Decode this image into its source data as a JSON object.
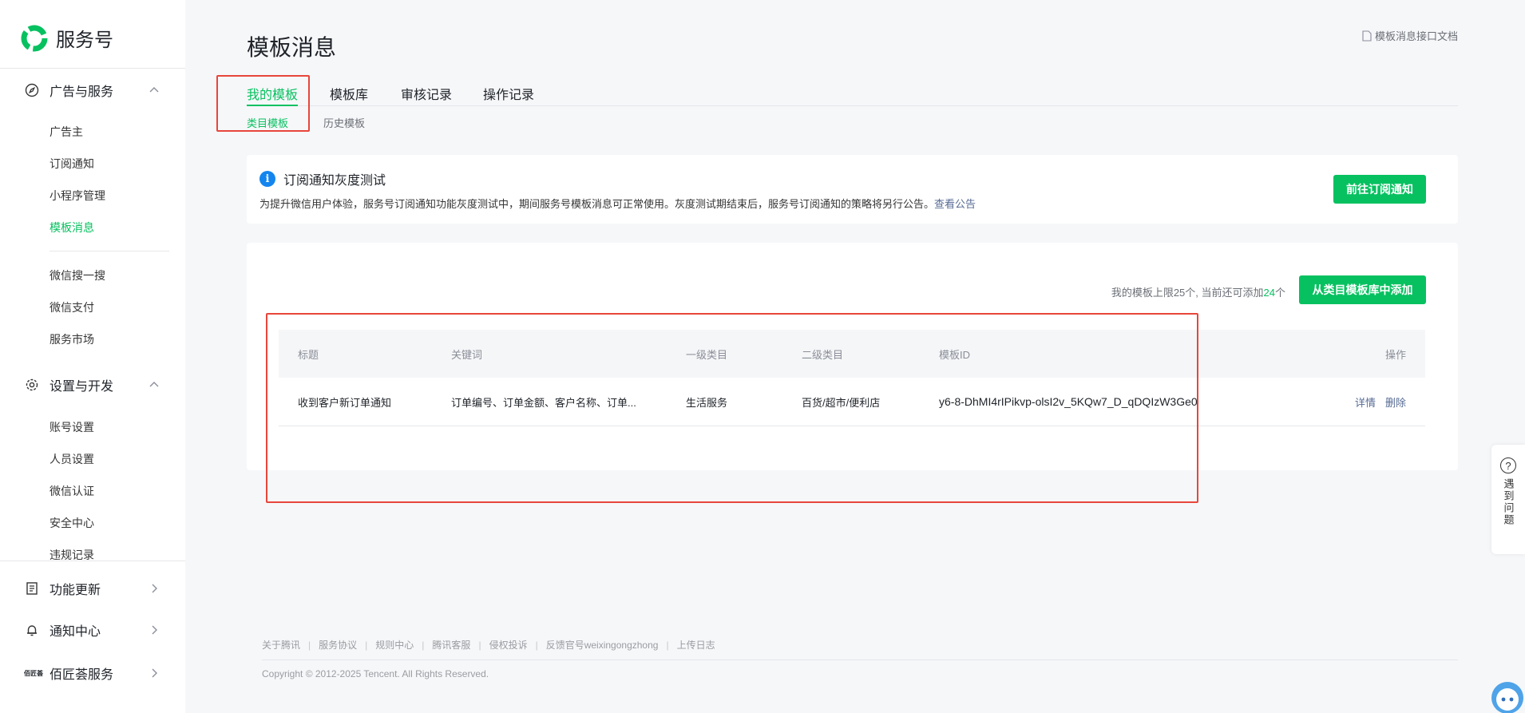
{
  "brand": {
    "name": "服务号"
  },
  "sidebar": {
    "groups": [
      {
        "label": "广告与服务",
        "items": [
          "广告主",
          "订阅通知",
          "小程序管理",
          "模板消息"
        ],
        "items2": [
          "微信搜一搜",
          "微信支付",
          "服务市场"
        ]
      },
      {
        "label": "设置与开发",
        "items": [
          "账号设置",
          "人员设置",
          "微信认证",
          "安全中心",
          "违规记录"
        ]
      }
    ],
    "bottom": [
      {
        "label": "功能更新"
      },
      {
        "label": "通知中心"
      },
      {
        "label": "佰匠荟服务",
        "avatar_text": "佰匠荟"
      }
    ]
  },
  "page": {
    "title": "模板消息",
    "doc_link": "模板消息接口文档",
    "tabs": [
      "我的模板",
      "模板库",
      "审核记录",
      "操作记录"
    ],
    "subtabs": [
      "类目模板",
      "历史模板"
    ]
  },
  "notice": {
    "title": "订阅通知灰度测试",
    "desc": "为提升微信用户体验，服务号订阅通知功能灰度测试中，期间服务号模板消息可正常使用。灰度测试期结束后，服务号订阅通知的策略将另行公告。",
    "link": "查看公告",
    "button": "前往订阅通知"
  },
  "templates": {
    "limit_prefix": "我的模板上限25个, 当前还可添加",
    "limit_num": "24",
    "limit_suffix": "个",
    "add_button": "从类目模板库中添加",
    "columns": [
      "标题",
      "关键词",
      "一级类目",
      "二级类目",
      "模板ID",
      "操作"
    ],
    "rows": [
      {
        "title": "收到客户新订单通知",
        "keywords": "订单编号、订单金额、客户名称、订单...",
        "cat1": "生活服务",
        "cat2": "百货/超市/便利店",
        "id": "y6-8-DhMI4rIPikvp-olsI2v_5KQw7_D_qDQIzW3Ge0",
        "op_detail": "详情",
        "op_delete": "删除"
      }
    ]
  },
  "footer": {
    "links": [
      "关于腾讯",
      "服务协议",
      "规则中心",
      "腾讯客服",
      "侵权投诉",
      "反馈官号weixingongzhong",
      "上传日志"
    ],
    "copyright": "Copyright © 2012-2025 Tencent. All Rights Reserved."
  },
  "help": {
    "label": "遇到问题"
  },
  "colors": {
    "accent": "#07c160",
    "link": "#576b95",
    "annotation": "#e8463b",
    "info": "#1485ee"
  }
}
